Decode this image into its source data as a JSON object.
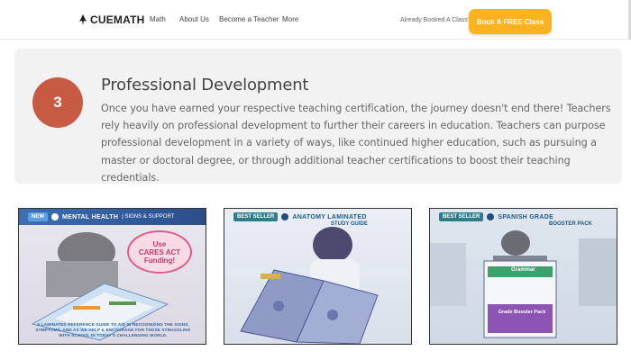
{
  "header": {
    "logo_text": "CUEMATH",
    "nav": [
      "Math",
      "About Us",
      "Become a Teacher",
      "More"
    ],
    "already_booked": "Already Booked A Class?",
    "cta_label": "Book A FREE Class",
    "cta_color": "#fcb221"
  },
  "step": {
    "number": "3",
    "title": "Professional Development",
    "body": "Once you have earned your respective teaching certification, the journey doesn't end there! Teachers rely heavily on professional development to further their careers in education. Teachers can purpose professional development in a variety of ways, like continued higher education, such as pursuing a master or doctoral degree, or through additional teacher certifications to boost their teaching credentials.",
    "circle_color": "#c75a42"
  },
  "products": [
    {
      "badge": "NEW",
      "title": "MENTAL HEALTH",
      "subtitle": "| SIGNS & SUPPORT",
      "callout": [
        "Use",
        "CARES ACT",
        "Funding!"
      ],
      "caption": "A LAMINATED REFERENCE GUIDE TO AID IN RECOGNIZING THE SIGNS, SYMPTOMS, AND AS WE HELP & ENCOURAGE FOR THOSE STRUGGLING WITH SCHOOL IN TODAY'S CHALLENGING WORLD."
    },
    {
      "badge": "BEST SELLER",
      "title": "ANATOMY LAMINATED",
      "subtitle": "STUDY GUIDE"
    },
    {
      "badge": "BEST SELLER",
      "title": "SPANISH GRADE",
      "subtitle": "BOOSTER PACK",
      "book_labels": [
        "Grammar",
        "Grade Booster Pack"
      ]
    }
  ]
}
